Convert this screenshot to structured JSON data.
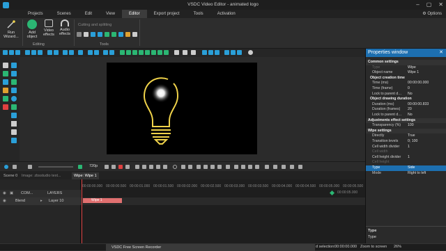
{
  "window": {
    "title": "VSDC Video Editor - animated logo"
  },
  "menu": {
    "items": [
      "Projects",
      "Scenes",
      "Edit",
      "View",
      "Editor",
      "Export project",
      "Tools",
      "Activation"
    ],
    "active": "Editor",
    "options": "Options"
  },
  "ribbon": {
    "run_wizard": "Run Wizard...",
    "add_object": "Add object",
    "video_effects": "Video effects",
    "audio_effects": "Audio effects",
    "editing_label": "Editing",
    "cutting": "Cutting and splitting",
    "tools_label": "Tools"
  },
  "preview_zoom": "720p",
  "properties": {
    "header": "Properties window",
    "rows": [
      {
        "t": "sec",
        "k": "Common settings",
        "v": ""
      },
      {
        "t": "dim",
        "k": "Type",
        "v": "Wipe"
      },
      {
        "t": "",
        "k": "Object name",
        "v": "Wipe 1"
      },
      {
        "t": "sub",
        "k": "Object creation time",
        "v": ""
      },
      {
        "t": "",
        "k": "Time (ms)",
        "v": "00:00:00.000"
      },
      {
        "t": "",
        "k": "Time (frame)",
        "v": "0"
      },
      {
        "t": "",
        "k": "Lock to parent d…",
        "v": "No"
      },
      {
        "t": "sub",
        "k": "Object drawing duration",
        "v": ""
      },
      {
        "t": "",
        "k": "Duration (ms)",
        "v": "00:00:00.833"
      },
      {
        "t": "",
        "k": "Duration (frames)",
        "v": "20"
      },
      {
        "t": "",
        "k": "Lock to parent d…",
        "v": "No"
      },
      {
        "t": "sec",
        "k": "Adjustments effect settings",
        "v": ""
      },
      {
        "t": "",
        "k": "Transparency (%)",
        "v": "100"
      },
      {
        "t": "sec",
        "k": "Wipe settings",
        "v": ""
      },
      {
        "t": "",
        "k": "Directly",
        "v": "True"
      },
      {
        "t": "",
        "k": "Transition levels",
        "v": "0; 100"
      },
      {
        "t": "",
        "k": "Cell width divider",
        "v": "1"
      },
      {
        "t": "dim",
        "k": "Cell width",
        "v": ""
      },
      {
        "t": "",
        "k": "Cell height divider",
        "v": "1"
      },
      {
        "t": "dim",
        "k": "Cell height",
        "v": ""
      },
      {
        "t": "sel",
        "k": "Type",
        "v": "Side"
      },
      {
        "t": "",
        "k": "Mode",
        "v": "Right to left"
      }
    ],
    "desc_title": "Type",
    "desc_text": "Type"
  },
  "tabs": [
    "Scene 0",
    "Image: zbsstudio text...",
    "Wipe: Wipe 1"
  ],
  "timeline": {
    "header_com": "COM...",
    "header_layers": "LAYERS",
    "row_blend": "Blend",
    "row_layer": "Layer 10",
    "clip_label": "Wipe 1",
    "ticks": [
      "00:00:00.000",
      "00:00:00.500",
      "00:00:01.000",
      "00:00:01.500",
      "00:00:02.000",
      "00:00:02.500",
      "00:00:03.000",
      "00:00:03.500",
      "00:00:04.000",
      "00:00:04.500",
      "00:00:05.000",
      "00:00:05.500"
    ],
    "end_time": "00:00:05.000"
  },
  "status": {
    "recorder": "VSDC Free Screen Recorder",
    "selection": "d selection:",
    "sel_time": "00:00:00.000",
    "zoom_label": "Zoom to screen",
    "zoom_value": "26%"
  },
  "colors": {
    "accent": "#1d6fb0",
    "bulb": "#f0d34a",
    "clip": "#e07070"
  }
}
